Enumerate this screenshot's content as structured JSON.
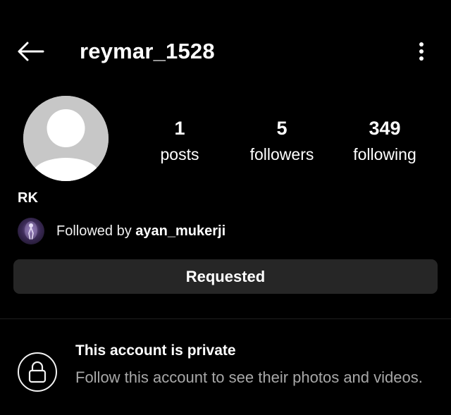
{
  "header": {
    "username": "reymar_1528",
    "back_icon": "arrow-left-icon",
    "more_icon": "more-vertical-icon"
  },
  "profile": {
    "avatar_icon": "default-avatar-icon",
    "display_name": "RK",
    "stats": [
      {
        "value": "1",
        "label": "posts"
      },
      {
        "value": "5",
        "label": "followers"
      },
      {
        "value": "349",
        "label": "following"
      }
    ],
    "followed_by": {
      "prefix": "Followed by",
      "username": "ayan_mukerji"
    }
  },
  "actions": {
    "requested_label": "Requested"
  },
  "private_notice": {
    "icon": "lock-icon",
    "title": "This account is private",
    "subtitle": "Follow this account to see their photos and videos."
  },
  "colors": {
    "background": "#000000",
    "button": "#262626",
    "secondary_text": "#a8a8a8",
    "avatar_placeholder": "#c7c7c7"
  }
}
